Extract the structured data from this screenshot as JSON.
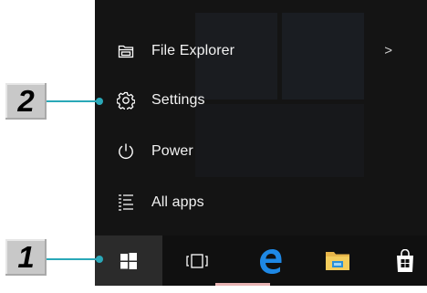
{
  "start_menu": {
    "items": [
      {
        "label": "File Explorer",
        "icon": "file-explorer-icon",
        "has_submenu": true,
        "chevron": ">"
      },
      {
        "label": "Settings",
        "icon": "gear-icon"
      },
      {
        "label": "Power",
        "icon": "power-icon"
      },
      {
        "label": "All apps",
        "icon": "list-icon"
      }
    ]
  },
  "taskbar": {
    "buttons": [
      {
        "name": "start",
        "icon": "windows-logo-icon"
      },
      {
        "name": "task-view",
        "icon": "task-view-icon",
        "glyph": "[▢]"
      },
      {
        "name": "edge",
        "icon": "edge-icon",
        "glyph": "e",
        "color": "#1e88e5"
      },
      {
        "name": "file-explorer",
        "icon": "folder-icon",
        "active": true
      },
      {
        "name": "store",
        "icon": "store-bag-icon"
      }
    ]
  },
  "callouts": [
    {
      "number": "2",
      "points_to": "Settings"
    },
    {
      "number": "1",
      "points_to": "Start button"
    }
  ],
  "colors": {
    "menu_bg": "#141414",
    "taskbar_bg": "#101010",
    "callout_bg": "#c8c8c8",
    "leader": "#2aa8b8"
  }
}
